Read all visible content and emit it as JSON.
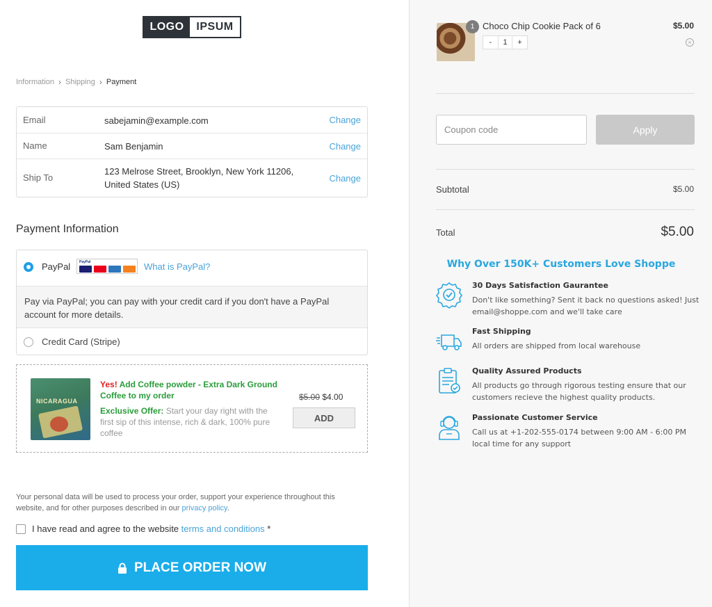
{
  "logo": {
    "part1": "LOGO",
    "part2": "IPSUM"
  },
  "breadcrumb": {
    "step1": "Information",
    "step2": "Shipping",
    "step3": "Payment"
  },
  "contact": {
    "rows": [
      {
        "label": "Email",
        "value": "sabejamin@example.com",
        "action": "Change"
      },
      {
        "label": "Name",
        "value": "Sam Benjamin",
        "action": "Change"
      },
      {
        "label": "Ship To",
        "value": "123 Melrose Street, Brooklyn, New York 11206, United States (US)",
        "action": "Change"
      }
    ]
  },
  "payment": {
    "title": "Payment Information",
    "paypal_label": "PayPal",
    "paypal_card_mark": "PayPal",
    "what_is": "What is PayPal?",
    "paypal_desc": "Pay via PayPal; you can pay with your credit card if you don't have a PayPal account for more details.",
    "card_label": "Credit Card (Stripe)",
    "selected": "paypal"
  },
  "offer": {
    "yes": "Yes!",
    "headline": "Add Coffee powder - Extra Dark Ground Coffee to my order",
    "image_text": "NICARAGUA",
    "exclusive_label": "Exclusive Offer:",
    "desc": "Start your day right with the first sip of this intense, rich & dark, 100% pure coffee",
    "old_price": "$5.00",
    "new_price": "$4.00",
    "add_label": "ADD"
  },
  "privacy": {
    "text": "Your personal data will be used to process your order, support your experience throughout this website, and for other purposes described in our",
    "link": "privacy policy",
    "period": "."
  },
  "terms": {
    "text": "I have read and agree to the website",
    "link": "terms and conditions",
    "required": "*"
  },
  "place_order": {
    "label": "PLACE ORDER NOW"
  },
  "cart": {
    "item": {
      "name": "Choco Chip Cookie Pack of 6",
      "price": "$5.00",
      "qty": "1",
      "badge": "1"
    },
    "stepper": {
      "minus": "-",
      "plus": "+"
    }
  },
  "coupon": {
    "placeholder": "Coupon code",
    "apply_label": "Apply"
  },
  "totals": {
    "subtotal_label": "Subtotal",
    "subtotal": "$5.00",
    "total_label": "Total",
    "total": "$5.00"
  },
  "why": {
    "title": "Why Over 150K+ Customers Love Shoppe"
  },
  "features": [
    {
      "title": "30 Days Satisfaction Gaurantee",
      "desc": "Don't like something? Sent it back no questions asked! Just email@shoppe.com and we'll take care",
      "icon": "badge-check-icon"
    },
    {
      "title": "Fast Shipping",
      "desc": "All orders are shipped from local warehouse",
      "icon": "truck-icon"
    },
    {
      "title": "Quality Assured Products",
      "desc": "All products go through rigorous testing ensure that our customers recieve the highest quality products.",
      "icon": "clipboard-check-icon"
    },
    {
      "title": "Passionate Customer Service",
      "desc": "Call us at +1-202-555-0174 between 9:00 AM - 6:00 PM local time for any support",
      "icon": "support-agent-icon"
    }
  ],
  "colors": {
    "accent": "#1aadea",
    "link": "#4aa3d8",
    "offer_green": "#2a9d3a",
    "offer_red": "#e02020",
    "why_blue": "#29a7df"
  }
}
